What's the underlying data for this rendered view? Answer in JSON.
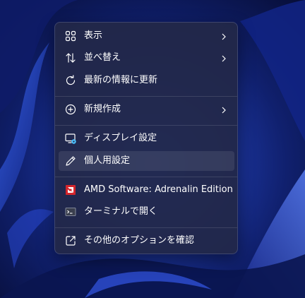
{
  "menu": {
    "items": [
      {
        "label": "表示",
        "icon": "view-grid-icon",
        "has_submenu": true
      },
      {
        "label": "並べ替え",
        "icon": "sort-arrows-icon",
        "has_submenu": true
      },
      {
        "label": "最新の情報に更新",
        "icon": "refresh-icon",
        "has_submenu": false
      },
      {
        "label": "新規作成",
        "icon": "add-circle-icon",
        "has_submenu": true
      },
      {
        "label": "ディスプレイ設定",
        "icon": "display-settings-icon",
        "has_submenu": false
      },
      {
        "label": "個人用設定",
        "icon": "pen-icon",
        "has_submenu": false,
        "hovered": true
      },
      {
        "label": "AMD Software: Adrenalin Edition",
        "icon": "amd-logo-icon",
        "has_submenu": false
      },
      {
        "label": "ターミナルで開く",
        "icon": "terminal-icon",
        "has_submenu": false
      },
      {
        "label": "その他のオプションを確認",
        "icon": "open-external-icon",
        "has_submenu": false
      }
    ]
  },
  "colors": {
    "menu_background": "#222848",
    "text": "#ffffff",
    "amd_red": "#d4252c",
    "display_icon_accent": "#4cc2ff"
  }
}
